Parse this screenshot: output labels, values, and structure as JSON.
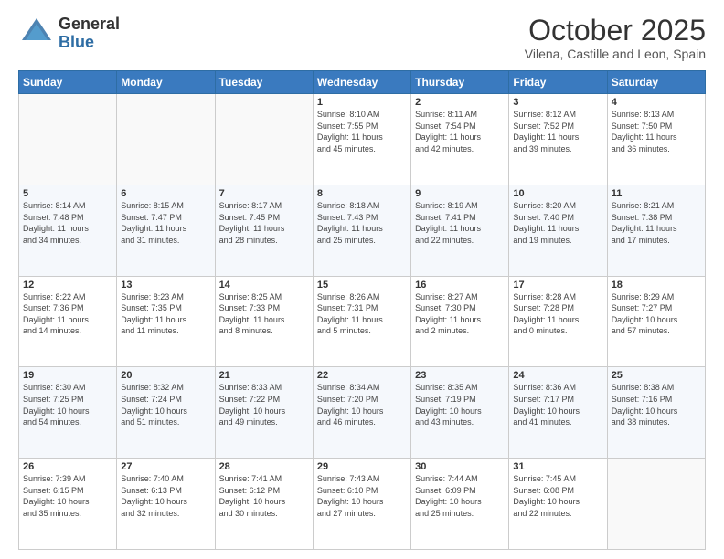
{
  "logo": {
    "general": "General",
    "blue": "Blue"
  },
  "title": "October 2025",
  "location": "Vilena, Castille and Leon, Spain",
  "days_header": [
    "Sunday",
    "Monday",
    "Tuesday",
    "Wednesday",
    "Thursday",
    "Friday",
    "Saturday"
  ],
  "weeks": [
    [
      {
        "day": "",
        "info": ""
      },
      {
        "day": "",
        "info": ""
      },
      {
        "day": "",
        "info": ""
      },
      {
        "day": "1",
        "info": "Sunrise: 8:10 AM\nSunset: 7:55 PM\nDaylight: 11 hours\nand 45 minutes."
      },
      {
        "day": "2",
        "info": "Sunrise: 8:11 AM\nSunset: 7:54 PM\nDaylight: 11 hours\nand 42 minutes."
      },
      {
        "day": "3",
        "info": "Sunrise: 8:12 AM\nSunset: 7:52 PM\nDaylight: 11 hours\nand 39 minutes."
      },
      {
        "day": "4",
        "info": "Sunrise: 8:13 AM\nSunset: 7:50 PM\nDaylight: 11 hours\nand 36 minutes."
      }
    ],
    [
      {
        "day": "5",
        "info": "Sunrise: 8:14 AM\nSunset: 7:48 PM\nDaylight: 11 hours\nand 34 minutes."
      },
      {
        "day": "6",
        "info": "Sunrise: 8:15 AM\nSunset: 7:47 PM\nDaylight: 11 hours\nand 31 minutes."
      },
      {
        "day": "7",
        "info": "Sunrise: 8:17 AM\nSunset: 7:45 PM\nDaylight: 11 hours\nand 28 minutes."
      },
      {
        "day": "8",
        "info": "Sunrise: 8:18 AM\nSunset: 7:43 PM\nDaylight: 11 hours\nand 25 minutes."
      },
      {
        "day": "9",
        "info": "Sunrise: 8:19 AM\nSunset: 7:41 PM\nDaylight: 11 hours\nand 22 minutes."
      },
      {
        "day": "10",
        "info": "Sunrise: 8:20 AM\nSunset: 7:40 PM\nDaylight: 11 hours\nand 19 minutes."
      },
      {
        "day": "11",
        "info": "Sunrise: 8:21 AM\nSunset: 7:38 PM\nDaylight: 11 hours\nand 17 minutes."
      }
    ],
    [
      {
        "day": "12",
        "info": "Sunrise: 8:22 AM\nSunset: 7:36 PM\nDaylight: 11 hours\nand 14 minutes."
      },
      {
        "day": "13",
        "info": "Sunrise: 8:23 AM\nSunset: 7:35 PM\nDaylight: 11 hours\nand 11 minutes."
      },
      {
        "day": "14",
        "info": "Sunrise: 8:25 AM\nSunset: 7:33 PM\nDaylight: 11 hours\nand 8 minutes."
      },
      {
        "day": "15",
        "info": "Sunrise: 8:26 AM\nSunset: 7:31 PM\nDaylight: 11 hours\nand 5 minutes."
      },
      {
        "day": "16",
        "info": "Sunrise: 8:27 AM\nSunset: 7:30 PM\nDaylight: 11 hours\nand 2 minutes."
      },
      {
        "day": "17",
        "info": "Sunrise: 8:28 AM\nSunset: 7:28 PM\nDaylight: 11 hours\nand 0 minutes."
      },
      {
        "day": "18",
        "info": "Sunrise: 8:29 AM\nSunset: 7:27 PM\nDaylight: 10 hours\nand 57 minutes."
      }
    ],
    [
      {
        "day": "19",
        "info": "Sunrise: 8:30 AM\nSunset: 7:25 PM\nDaylight: 10 hours\nand 54 minutes."
      },
      {
        "day": "20",
        "info": "Sunrise: 8:32 AM\nSunset: 7:24 PM\nDaylight: 10 hours\nand 51 minutes."
      },
      {
        "day": "21",
        "info": "Sunrise: 8:33 AM\nSunset: 7:22 PM\nDaylight: 10 hours\nand 49 minutes."
      },
      {
        "day": "22",
        "info": "Sunrise: 8:34 AM\nSunset: 7:20 PM\nDaylight: 10 hours\nand 46 minutes."
      },
      {
        "day": "23",
        "info": "Sunrise: 8:35 AM\nSunset: 7:19 PM\nDaylight: 10 hours\nand 43 minutes."
      },
      {
        "day": "24",
        "info": "Sunrise: 8:36 AM\nSunset: 7:17 PM\nDaylight: 10 hours\nand 41 minutes."
      },
      {
        "day": "25",
        "info": "Sunrise: 8:38 AM\nSunset: 7:16 PM\nDaylight: 10 hours\nand 38 minutes."
      }
    ],
    [
      {
        "day": "26",
        "info": "Sunrise: 7:39 AM\nSunset: 6:15 PM\nDaylight: 10 hours\nand 35 minutes."
      },
      {
        "day": "27",
        "info": "Sunrise: 7:40 AM\nSunset: 6:13 PM\nDaylight: 10 hours\nand 32 minutes."
      },
      {
        "day": "28",
        "info": "Sunrise: 7:41 AM\nSunset: 6:12 PM\nDaylight: 10 hours\nand 30 minutes."
      },
      {
        "day": "29",
        "info": "Sunrise: 7:43 AM\nSunset: 6:10 PM\nDaylight: 10 hours\nand 27 minutes."
      },
      {
        "day": "30",
        "info": "Sunrise: 7:44 AM\nSunset: 6:09 PM\nDaylight: 10 hours\nand 25 minutes."
      },
      {
        "day": "31",
        "info": "Sunrise: 7:45 AM\nSunset: 6:08 PM\nDaylight: 10 hours\nand 22 minutes."
      },
      {
        "day": "",
        "info": ""
      }
    ]
  ]
}
